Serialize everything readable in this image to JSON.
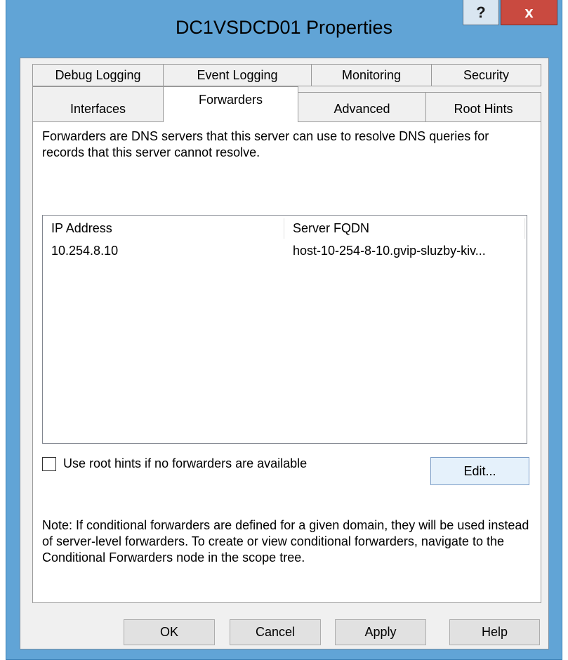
{
  "window": {
    "title": "DC1VSDCD01 Properties",
    "help_label": "?",
    "close_label": "x"
  },
  "tabs": {
    "row1": [
      "Debug Logging",
      "Event Logging",
      "Monitoring",
      "Security"
    ],
    "row2": [
      "Interfaces",
      "Forwarders",
      "Advanced",
      "Root Hints"
    ],
    "active": "Forwarders"
  },
  "forwarders": {
    "description": "Forwarders are DNS servers that this server can use to resolve DNS queries for records that this server cannot resolve.",
    "columns": [
      "IP Address",
      "Server FQDN"
    ],
    "rows": [
      {
        "ip": "10.254.8.10",
        "fqdn": "host-10-254-8-10.gvip-sluzby-kiv..."
      }
    ],
    "use_root_hints_label": "Use root hints if no forwarders are available",
    "use_root_hints_checked": false,
    "edit_label": "Edit...",
    "note": "Note: If conditional forwarders are defined for a given domain, they will be used instead of server-level forwarders.  To create or view conditional forwarders, navigate to the Conditional Forwarders node in the scope tree."
  },
  "buttons": {
    "ok": "OK",
    "cancel": "Cancel",
    "apply": "Apply",
    "help": "Help"
  }
}
